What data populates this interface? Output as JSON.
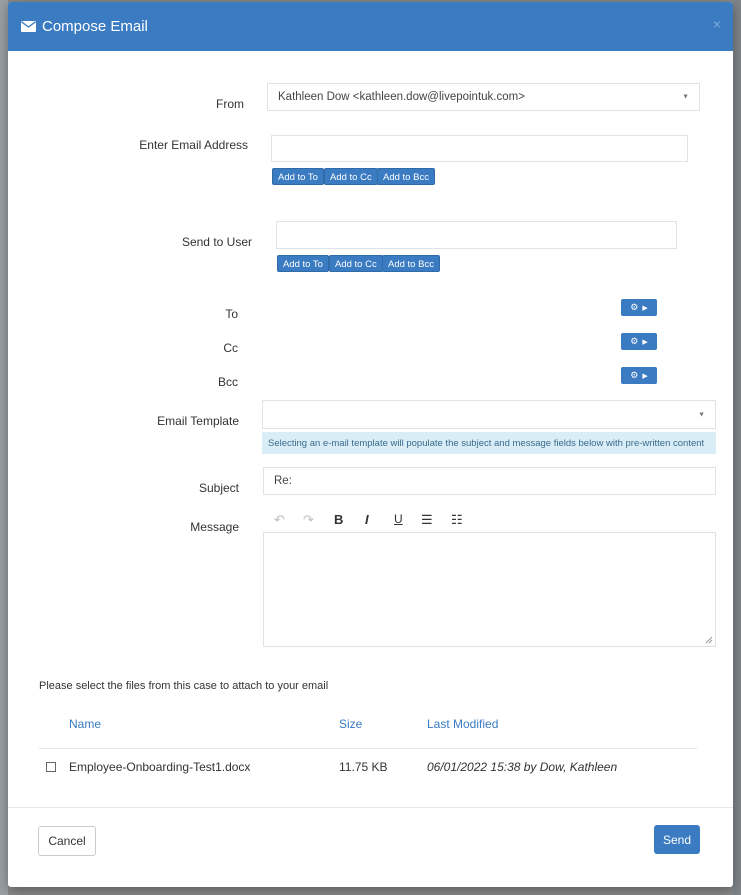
{
  "modal": {
    "title": "Compose Email",
    "close_glyph": "×",
    "header_color": "#3a7bc2",
    "header_icon": "envelope-icon"
  },
  "form": {
    "from": {
      "label": "From",
      "value": "Kathleen Dow <kathleen.dow@livepointuk.com>"
    },
    "email_address": {
      "label": "Enter Email Address",
      "value": ""
    },
    "email_buttons": {
      "to": "Add to To",
      "cc": "Add to Cc",
      "bcc": "Add to Bcc"
    },
    "send_to_user": {
      "label": "Send to User",
      "value": ""
    },
    "user_buttons": {
      "to": "Add to To",
      "cc": "Add to Cc",
      "bcc": "Add to Bcc"
    },
    "to_label": "To",
    "cc_label": "Cc",
    "bcc_label": "Bcc",
    "recipient_button_icons": [
      "gear-icon",
      "caret-right-icon"
    ],
    "template": {
      "label": "Email Template",
      "value": "",
      "info": "Selecting an e-mail template will populate the subject and message fields below with pre-written content"
    },
    "subject": {
      "label": "Subject",
      "value": "Re:"
    },
    "message": {
      "label": "Message",
      "toolbar": [
        {
          "name": "undo-icon",
          "glyph": "↶",
          "enabled": false
        },
        {
          "name": "redo-icon",
          "glyph": "↷",
          "enabled": false
        },
        {
          "name": "bold-icon",
          "glyph": "B",
          "enabled": true
        },
        {
          "name": "italic-icon",
          "glyph": "I",
          "enabled": true
        },
        {
          "name": "underline-icon",
          "glyph": "U",
          "enabled": true
        },
        {
          "name": "bullet-list-icon",
          "glyph": "☰",
          "enabled": true
        },
        {
          "name": "numbered-list-icon",
          "glyph": "☷",
          "enabled": true
        }
      ],
      "value": ""
    }
  },
  "attachments": {
    "prompt": "Please select the files from this case to attach to your email",
    "columns": {
      "name": "Name",
      "size": "Size",
      "modified": "Last Modified"
    },
    "rows": [
      {
        "name": "Employee-Onboarding-Test1.docx",
        "size": "11.75 KB",
        "modified": "06/01/2022 15:38 by Dow, Kathleen",
        "checked": false
      }
    ]
  },
  "footer": {
    "cancel": "Cancel",
    "send": "Send"
  }
}
